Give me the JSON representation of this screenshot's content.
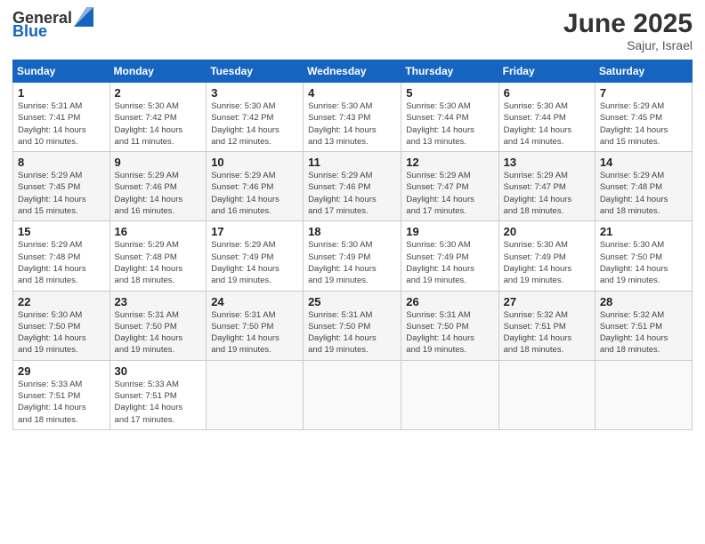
{
  "header": {
    "logo": {
      "text_general": "General",
      "text_blue": "Blue"
    },
    "title": "June 2025",
    "location": "Sajur, Israel"
  },
  "weekdays": [
    "Sunday",
    "Monday",
    "Tuesday",
    "Wednesday",
    "Thursday",
    "Friday",
    "Saturday"
  ],
  "weeks": [
    [
      {
        "day": "1",
        "rise": "5:31 AM",
        "set": "7:41 PM",
        "daylight": "14 hours and 10 minutes."
      },
      {
        "day": "2",
        "rise": "5:30 AM",
        "set": "7:42 PM",
        "daylight": "14 hours and 11 minutes."
      },
      {
        "day": "3",
        "rise": "5:30 AM",
        "set": "7:42 PM",
        "daylight": "14 hours and 12 minutes."
      },
      {
        "day": "4",
        "rise": "5:30 AM",
        "set": "7:43 PM",
        "daylight": "14 hours and 13 minutes."
      },
      {
        "day": "5",
        "rise": "5:30 AM",
        "set": "7:44 PM",
        "daylight": "14 hours and 13 minutes."
      },
      {
        "day": "6",
        "rise": "5:30 AM",
        "set": "7:44 PM",
        "daylight": "14 hours and 14 minutes."
      },
      {
        "day": "7",
        "rise": "5:29 AM",
        "set": "7:45 PM",
        "daylight": "14 hours and 15 minutes."
      }
    ],
    [
      {
        "day": "8",
        "rise": "5:29 AM",
        "set": "7:45 PM",
        "daylight": "14 hours and 15 minutes."
      },
      {
        "day": "9",
        "rise": "5:29 AM",
        "set": "7:46 PM",
        "daylight": "14 hours and 16 minutes."
      },
      {
        "day": "10",
        "rise": "5:29 AM",
        "set": "7:46 PM",
        "daylight": "14 hours and 16 minutes."
      },
      {
        "day": "11",
        "rise": "5:29 AM",
        "set": "7:46 PM",
        "daylight": "14 hours and 17 minutes."
      },
      {
        "day": "12",
        "rise": "5:29 AM",
        "set": "7:47 PM",
        "daylight": "14 hours and 17 minutes."
      },
      {
        "day": "13",
        "rise": "5:29 AM",
        "set": "7:47 PM",
        "daylight": "14 hours and 18 minutes."
      },
      {
        "day": "14",
        "rise": "5:29 AM",
        "set": "7:48 PM",
        "daylight": "14 hours and 18 minutes."
      }
    ],
    [
      {
        "day": "15",
        "rise": "5:29 AM",
        "set": "7:48 PM",
        "daylight": "14 hours and 18 minutes."
      },
      {
        "day": "16",
        "rise": "5:29 AM",
        "set": "7:48 PM",
        "daylight": "14 hours and 18 minutes."
      },
      {
        "day": "17",
        "rise": "5:29 AM",
        "set": "7:49 PM",
        "daylight": "14 hours and 19 minutes."
      },
      {
        "day": "18",
        "rise": "5:30 AM",
        "set": "7:49 PM",
        "daylight": "14 hours and 19 minutes."
      },
      {
        "day": "19",
        "rise": "5:30 AM",
        "set": "7:49 PM",
        "daylight": "14 hours and 19 minutes."
      },
      {
        "day": "20",
        "rise": "5:30 AM",
        "set": "7:49 PM",
        "daylight": "14 hours and 19 minutes."
      },
      {
        "day": "21",
        "rise": "5:30 AM",
        "set": "7:50 PM",
        "daylight": "14 hours and 19 minutes."
      }
    ],
    [
      {
        "day": "22",
        "rise": "5:30 AM",
        "set": "7:50 PM",
        "daylight": "14 hours and 19 minutes."
      },
      {
        "day": "23",
        "rise": "5:31 AM",
        "set": "7:50 PM",
        "daylight": "14 hours and 19 minutes."
      },
      {
        "day": "24",
        "rise": "5:31 AM",
        "set": "7:50 PM",
        "daylight": "14 hours and 19 minutes."
      },
      {
        "day": "25",
        "rise": "5:31 AM",
        "set": "7:50 PM",
        "daylight": "14 hours and 19 minutes."
      },
      {
        "day": "26",
        "rise": "5:31 AM",
        "set": "7:50 PM",
        "daylight": "14 hours and 19 minutes."
      },
      {
        "day": "27",
        "rise": "5:32 AM",
        "set": "7:51 PM",
        "daylight": "14 hours and 18 minutes."
      },
      {
        "day": "28",
        "rise": "5:32 AM",
        "set": "7:51 PM",
        "daylight": "14 hours and 18 minutes."
      }
    ],
    [
      {
        "day": "29",
        "rise": "5:33 AM",
        "set": "7:51 PM",
        "daylight": "14 hours and 18 minutes."
      },
      {
        "day": "30",
        "rise": "5:33 AM",
        "set": "7:51 PM",
        "daylight": "14 hours and 17 minutes."
      },
      null,
      null,
      null,
      null,
      null
    ]
  ]
}
